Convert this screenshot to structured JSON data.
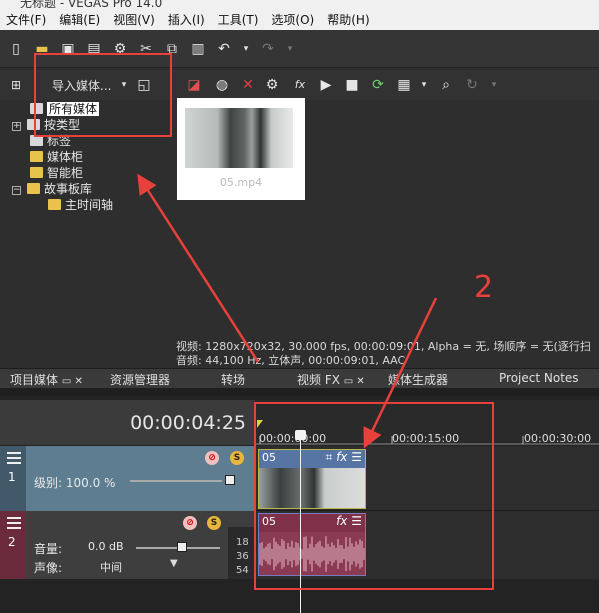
{
  "app": {
    "title": "无标题 - VEGAS Pro 14.0"
  },
  "menu": [
    "文件(F)",
    "编辑(E)",
    "视图(V)",
    "插入(I)",
    "工具(T)",
    "选项(O)",
    "帮助(H)"
  ],
  "media_toolbar": {
    "import_label": "导入媒体..."
  },
  "tree": {
    "items": [
      {
        "label": "所有媒体",
        "selected": true,
        "expander": ""
      },
      {
        "label": "按类型",
        "expander": "+"
      },
      {
        "label": "标签",
        "expander": ""
      },
      {
        "label": "媒体柜",
        "expander": ""
      },
      {
        "label": "智能柜",
        "expander": ""
      },
      {
        "label": "故事板库",
        "expander": "−"
      },
      {
        "label": "主时间轴",
        "expander": ""
      }
    ]
  },
  "media": {
    "filename": "05.mp4"
  },
  "info": {
    "video": "视频: 1280x720x32, 30.000 fps, 00:00:09:01, Alpha = 无, 场顺序 = 无(逐行扫",
    "audio": "音频: 44,100 Hz, 立体声, 00:00:09:01, AAC"
  },
  "tabs": [
    {
      "label": "项目媒体"
    },
    {
      "label": "资源管理器"
    },
    {
      "label": "转场"
    },
    {
      "label": "视频 FX"
    },
    {
      "label": "媒体生成器"
    },
    {
      "label": "Project Notes"
    }
  ],
  "timeline": {
    "timecode": "00:00:04:25",
    "ruler": [
      "00:00:00:00",
      "00:00:15:00",
      "00:00:30:00"
    ],
    "video_track": {
      "number": "1",
      "level_label": "级别: 100.0 %"
    },
    "audio_track": {
      "number": "2",
      "volume_label": "音量:",
      "volume_value": "0.0 dB",
      "pan_label": "声像:",
      "pan_value": "中间",
      "meter": [
        "18",
        "36",
        "54"
      ]
    },
    "video_clip": {
      "name": "05"
    },
    "audio_clip": {
      "name": "05"
    }
  },
  "annotations": {
    "marker_label": "2",
    "color": "#e8403a"
  },
  "colors": {
    "video_track": "#5e7d90",
    "video_clip_head": "#5674a4",
    "audio_clip": "#8a3a52"
  }
}
